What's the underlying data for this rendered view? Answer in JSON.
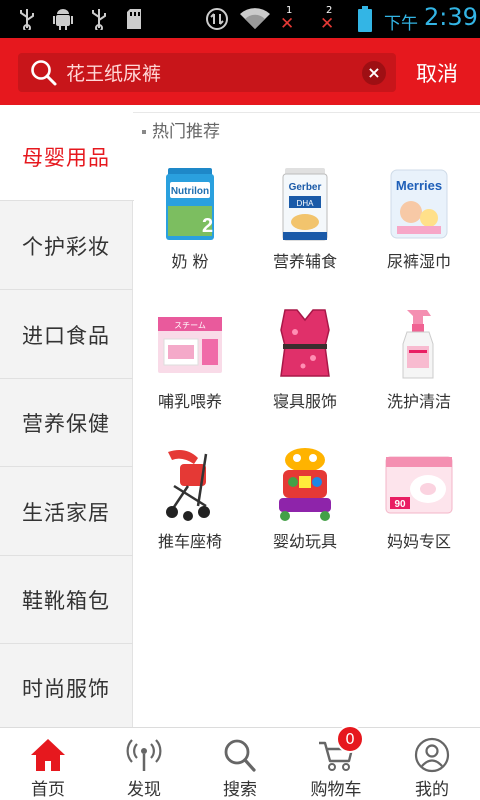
{
  "status_bar": {
    "icons": [
      "usb-icon",
      "android-debug-icon",
      "usb-icon",
      "sd-card-icon",
      "data-sync-icon",
      "wifi-icon",
      "sim1-no-signal-icon",
      "sim2-no-signal-icon",
      "battery-icon"
    ],
    "sim1": "1",
    "sim2": "2",
    "ampm": "下午",
    "time": "2:39"
  },
  "header": {
    "search_text": "花王纸尿裤",
    "cancel_label": "取消",
    "accent_color": "#e6181e"
  },
  "sidebar": {
    "items": [
      {
        "label": "母婴用品",
        "active": true
      },
      {
        "label": "个护彩妆",
        "active": false
      },
      {
        "label": "进口食品",
        "active": false
      },
      {
        "label": "营养保健",
        "active": false
      },
      {
        "label": "生活家居",
        "active": false
      },
      {
        "label": "鞋靴箱包",
        "active": false
      },
      {
        "label": "时尚服饰",
        "active": false
      }
    ]
  },
  "content": {
    "section_title": "热门推荐",
    "categories": [
      {
        "label": "奶 粉",
        "icon": "milk-powder-can-image"
      },
      {
        "label": "营养辅食",
        "icon": "baby-cereal-can-image"
      },
      {
        "label": "尿裤湿巾",
        "icon": "diaper-pack-image"
      },
      {
        "label": "哺乳喂养",
        "icon": "feeding-box-image"
      },
      {
        "label": "寝具服饰",
        "icon": "baby-swim-vest-image"
      },
      {
        "label": "洗护清洁",
        "icon": "spray-bottle-image"
      },
      {
        "label": "推车座椅",
        "icon": "stroller-image"
      },
      {
        "label": "婴幼玩具",
        "icon": "baby-walker-toy-image"
      },
      {
        "label": "妈妈专区",
        "icon": "nursing-pads-image"
      }
    ]
  },
  "bottom_nav": {
    "items": [
      {
        "label": "首页",
        "icon": "home-icon",
        "active": true
      },
      {
        "label": "发现",
        "icon": "discover-signal-icon",
        "active": false
      },
      {
        "label": "搜索",
        "icon": "search-icon",
        "active": false
      },
      {
        "label": "购物车",
        "icon": "cart-icon",
        "active": false
      },
      {
        "label": "我的",
        "icon": "profile-icon",
        "active": false
      }
    ],
    "cart_count": "0"
  }
}
